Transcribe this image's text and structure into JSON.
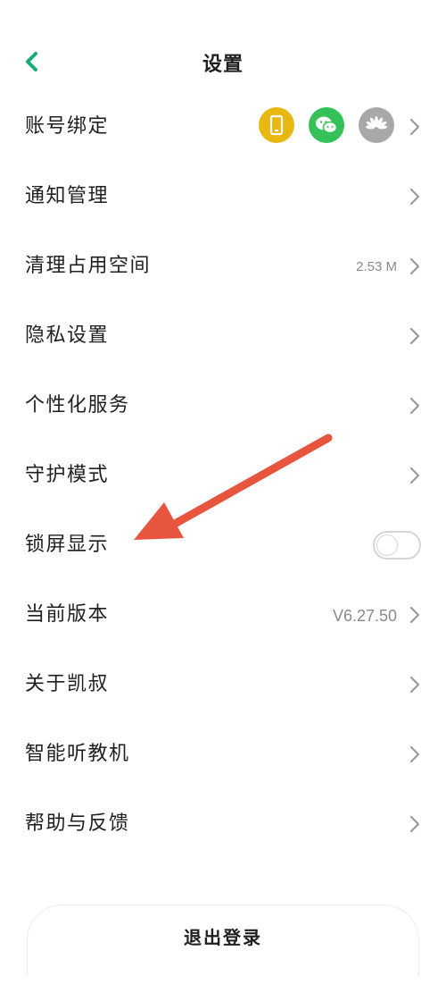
{
  "colors": {
    "accent": "#1aaa78",
    "arrow": "#e8553e",
    "chevron": "#9a9a9a"
  },
  "header": {
    "title": "设置",
    "back_icon": "chevron-left-icon"
  },
  "rows": [
    {
      "label": "账号绑定",
      "badges": [
        "phone-icon",
        "wechat-icon",
        "huawei-icon"
      ]
    },
    {
      "label": "通知管理"
    },
    {
      "label": "清理占用空间",
      "value": "2.53 M"
    },
    {
      "label": "隐私设置"
    },
    {
      "label": "个性化服务"
    },
    {
      "label": "守护模式"
    },
    {
      "label": "锁屏显示",
      "toggle": false
    },
    {
      "label": "当前版本",
      "value": "V6.27.50"
    },
    {
      "label": "关于凯叔"
    },
    {
      "label": "智能听教机"
    },
    {
      "label": "帮助与反馈"
    }
  ],
  "logout": {
    "label": "退出登录"
  }
}
